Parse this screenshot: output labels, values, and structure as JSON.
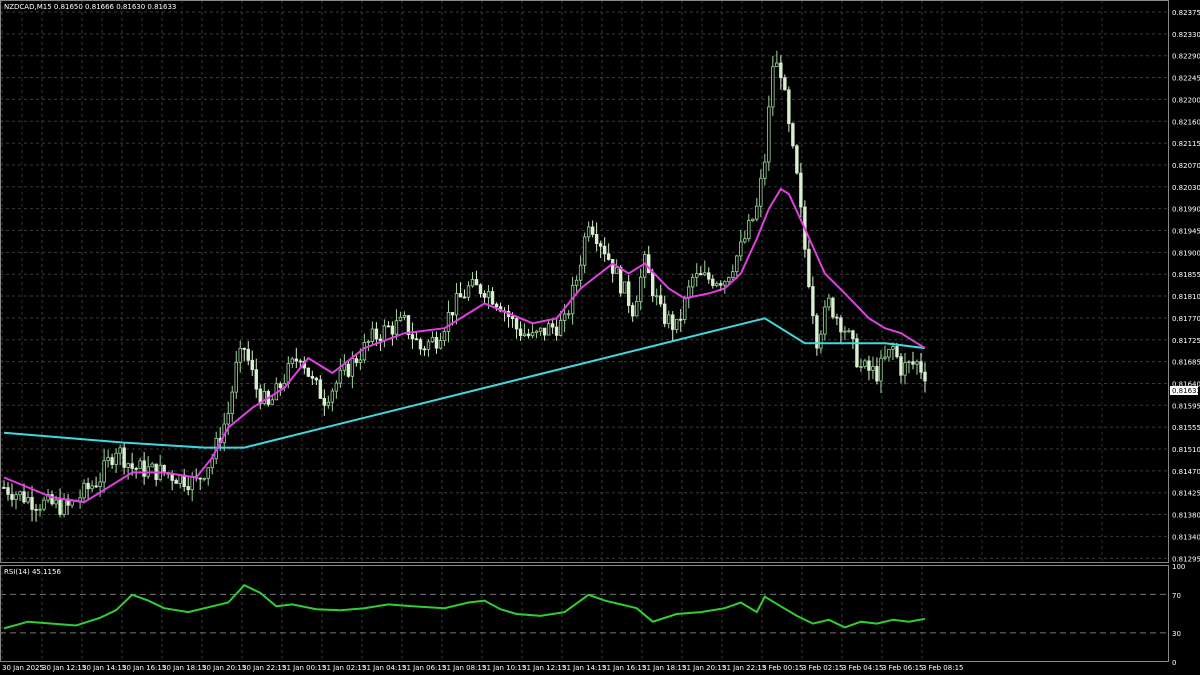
{
  "header": {
    "symbol_info": "NZDCAD,M15  0.81650 0.81666 0.81630 0.81633"
  },
  "current_price_label": "0.81633",
  "colors": {
    "background": "#000000",
    "grid": "#4a4a4a",
    "bull_candle": "#9bd79b",
    "bear_candle": "#d9f0d0",
    "ma_fast": "#e040e0",
    "ma_slow": "#40d8e0",
    "rsi_line": "#32cd32",
    "text": "#ffffff"
  },
  "chart_data": [
    {
      "type": "candlestick",
      "title": "NZDCAD,M15",
      "ohlc_header": {
        "open": 0.8165,
        "high": 0.81666,
        "low": 0.8163,
        "close": 0.81633
      },
      "ylim": [
        0.8125,
        0.8238
      ],
      "y_ticks": [
        "0.82375",
        "0.82330",
        "0.82290",
        "0.82245",
        "0.82200",
        "0.82160",
        "0.82115",
        "0.82070",
        "0.82030",
        "0.81990",
        "0.81945",
        "0.81900",
        "0.81855",
        "0.81810",
        "0.81770",
        "0.81725",
        "0.81685",
        "0.81640",
        "0.81595",
        "0.81555",
        "0.81510",
        "0.81470",
        "0.81425",
        "0.81380",
        "0.81340",
        "0.81295"
      ],
      "x_ticks": [
        "30 Jan 2025",
        "30 Jan 12:15",
        "30 Jan 14:15",
        "30 Jan 16:15",
        "30 Jan 18:15",
        "30 Jan 20:15",
        "30 Jan 22:15",
        "31 Jan 00:15",
        "31 Jan 02:15",
        "31 Jan 04:15",
        "31 Jan 06:15",
        "31 Jan 08:15",
        "31 Jan 10:15",
        "31 Jan 12:15",
        "31 Jan 14:15",
        "31 Jan 16:15",
        "31 Jan 18:15",
        "31 Jan 20:15",
        "31 Jan 22:15",
        "3 Feb 00:15",
        "3 Feb 02:15",
        "3 Feb 04:15",
        "3 Feb 06:15",
        "3 Feb 08:15"
      ],
      "close_path": [
        [
          0,
          0.814
        ],
        [
          8,
          0.8137
        ],
        [
          16,
          0.8136
        ],
        [
          24,
          0.8142
        ],
        [
          28,
          0.8148
        ],
        [
          32,
          0.8144
        ],
        [
          40,
          0.8143
        ],
        [
          48,
          0.8141
        ],
        [
          52,
          0.8146
        ],
        [
          56,
          0.8155
        ],
        [
          58,
          0.8164
        ],
        [
          60,
          0.8168
        ],
        [
          63,
          0.816
        ],
        [
          66,
          0.8156
        ],
        [
          70,
          0.8162
        ],
        [
          74,
          0.8167
        ],
        [
          77,
          0.8161
        ],
        [
          80,
          0.8158
        ],
        [
          84,
          0.8162
        ],
        [
          88,
          0.8166
        ],
        [
          92,
          0.817
        ],
        [
          96,
          0.8172
        ],
        [
          100,
          0.8173
        ],
        [
          104,
          0.8168
        ],
        [
          108,
          0.817
        ],
        [
          112,
          0.8176
        ],
        [
          116,
          0.818
        ],
        [
          120,
          0.818
        ],
        [
          124,
          0.8177
        ],
        [
          128,
          0.8172
        ],
        [
          132,
          0.817
        ],
        [
          136,
          0.8172
        ],
        [
          140,
          0.8173
        ],
        [
          143,
          0.8182
        ],
        [
          146,
          0.8194
        ],
        [
          150,
          0.8188
        ],
        [
          154,
          0.8181
        ],
        [
          157,
          0.8176
        ],
        [
          160,
          0.8185
        ],
        [
          164,
          0.8175
        ],
        [
          168,
          0.8172
        ],
        [
          172,
          0.8182
        ],
        [
          176,
          0.8182
        ],
        [
          180,
          0.8182
        ],
        [
          184,
          0.8188
        ],
        [
          188,
          0.8196
        ],
        [
          190,
          0.8206
        ],
        [
          192,
          0.8225
        ],
        [
          194,
          0.8224
        ],
        [
          196,
          0.8212
        ],
        [
          198,
          0.8202
        ],
        [
          200,
          0.8188
        ],
        [
          203,
          0.817
        ],
        [
          206,
          0.8177
        ],
        [
          210,
          0.8172
        ],
        [
          214,
          0.8164
        ],
        [
          218,
          0.8163
        ],
        [
          222,
          0.8168
        ],
        [
          224,
          0.8164
        ],
        [
          228,
          0.8165
        ],
        [
          230,
          0.8163
        ]
      ],
      "series": [
        {
          "name": "MA fast",
          "values": [
            [
              0,
              0.8142
            ],
            [
              12,
              0.8138
            ],
            [
              20,
              0.8137
            ],
            [
              32,
              0.8143
            ],
            [
              40,
              0.8143
            ],
            [
              48,
              0.8142
            ],
            [
              52,
              0.8146
            ],
            [
              56,
              0.8152
            ],
            [
              62,
              0.8156
            ],
            [
              70,
              0.816
            ],
            [
              76,
              0.8166
            ],
            [
              82,
              0.8163
            ],
            [
              90,
              0.8168
            ],
            [
              100,
              0.8171
            ],
            [
              110,
              0.8172
            ],
            [
              120,
              0.8177
            ],
            [
              126,
              0.8175
            ],
            [
              132,
              0.8173
            ],
            [
              138,
              0.8174
            ],
            [
              144,
              0.818
            ],
            [
              152,
              0.8185
            ],
            [
              156,
              0.8183
            ],
            [
              160,
              0.8185
            ],
            [
              166,
              0.818
            ],
            [
              170,
              0.8178
            ],
            [
              176,
              0.8179
            ],
            [
              180,
              0.818
            ],
            [
              184,
              0.8183
            ],
            [
              188,
              0.819
            ],
            [
              191,
              0.8196
            ],
            [
              194,
              0.82
            ],
            [
              196,
              0.8199
            ],
            [
              200,
              0.8192
            ],
            [
              205,
              0.8183
            ],
            [
              210,
              0.8179
            ],
            [
              216,
              0.8174
            ],
            [
              220,
              0.8172
            ],
            [
              224,
              0.8171
            ],
            [
              228,
              0.8169
            ],
            [
              230,
              0.8168
            ]
          ]
        },
        {
          "name": "MA slow",
          "values": [
            [
              0,
              0.8151
            ],
            [
              30,
              0.8149
            ],
            [
              50,
              0.8148
            ],
            [
              60,
              0.8148
            ],
            [
              80,
              0.8152
            ],
            [
              100,
              0.8156
            ],
            [
              120,
              0.816
            ],
            [
              140,
              0.8164
            ],
            [
              160,
              0.8168
            ],
            [
              180,
              0.8172
            ],
            [
              190,
              0.8174
            ],
            [
              200,
              0.8169
            ],
            [
              210,
              0.8169
            ],
            [
              220,
              0.8169
            ],
            [
              230,
              0.8168
            ]
          ]
        }
      ]
    },
    {
      "type": "line",
      "title": "RSI(14) 45.1156",
      "ylim": [
        0,
        100
      ],
      "y_ticks": [
        100,
        70,
        30,
        0
      ],
      "levels": [
        70,
        30
      ],
      "series": [
        {
          "name": "RSI(14)",
          "values": [
            [
              0,
              35
            ],
            [
              6,
              42
            ],
            [
              12,
              40
            ],
            [
              18,
              38
            ],
            [
              24,
              46
            ],
            [
              28,
              54
            ],
            [
              32,
              70
            ],
            [
              36,
              64
            ],
            [
              40,
              56
            ],
            [
              46,
              52
            ],
            [
              52,
              58
            ],
            [
              56,
              62
            ],
            [
              60,
              80
            ],
            [
              64,
              72
            ],
            [
              68,
              58
            ],
            [
              72,
              60
            ],
            [
              78,
              55
            ],
            [
              84,
              54
            ],
            [
              90,
              56
            ],
            [
              96,
              60
            ],
            [
              102,
              58
            ],
            [
              110,
              56
            ],
            [
              116,
              62
            ],
            [
              120,
              64
            ],
            [
              124,
              55
            ],
            [
              128,
              50
            ],
            [
              134,
              48
            ],
            [
              140,
              52
            ],
            [
              146,
              70
            ],
            [
              150,
              64
            ],
            [
              154,
              60
            ],
            [
              158,
              56
            ],
            [
              162,
              42
            ],
            [
              168,
              50
            ],
            [
              174,
              52
            ],
            [
              180,
              56
            ],
            [
              184,
              62
            ],
            [
              188,
              52
            ],
            [
              190,
              68
            ],
            [
              194,
              58
            ],
            [
              198,
              48
            ],
            [
              202,
              40
            ],
            [
              206,
              44
            ],
            [
              210,
              36
            ],
            [
              214,
              42
            ],
            [
              218,
              40
            ],
            [
              222,
              44
            ],
            [
              226,
              42
            ],
            [
              230,
              45
            ]
          ]
        }
      ]
    }
  ]
}
